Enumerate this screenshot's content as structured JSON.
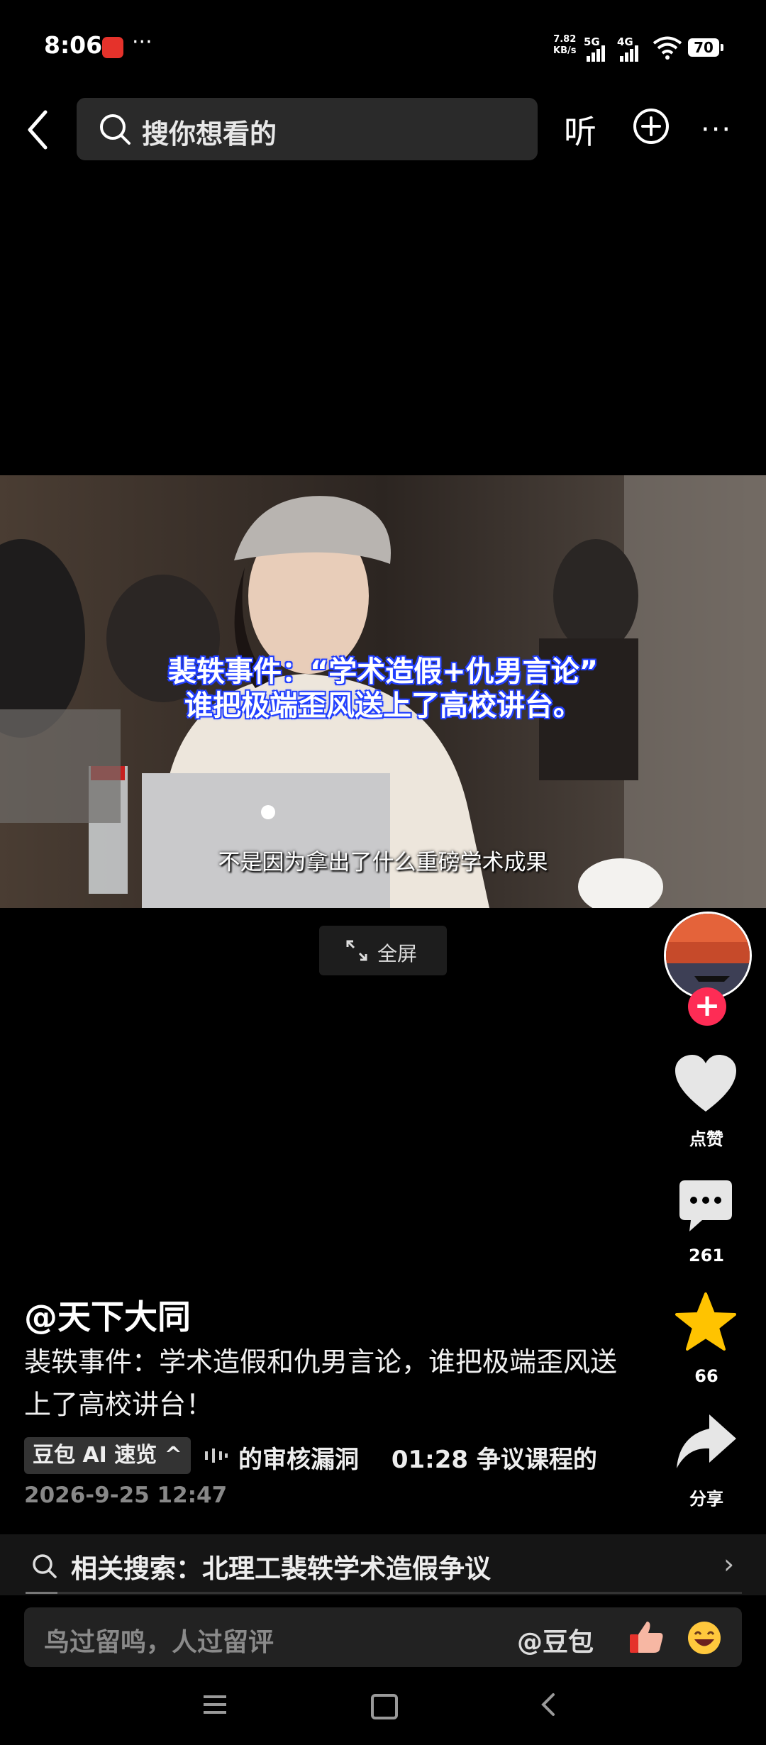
{
  "status_bar": {
    "time": "8:06",
    "more": "···",
    "net_speed_value": "7.82",
    "net_speed_unit": "KB/s",
    "sig1_label": "5G",
    "sig2_label": "4G",
    "battery": "70"
  },
  "top_nav": {
    "search_placeholder": "搜你想看的",
    "listen_label": "听",
    "more_label": "···"
  },
  "video": {
    "title_line1": "裴轶事件：“学术造假+仇男言论”",
    "title_line2": "谁把极端歪风送上了高校讲台。",
    "caption": "不是因为拿出了什么重磅学术成果",
    "fullscreen_label": "全屏"
  },
  "rail": {
    "follow": "+",
    "like_label": "点赞",
    "comment_count": "261",
    "favorite_count": "66",
    "share_label": "分享"
  },
  "post": {
    "author": "@天下大同",
    "description": "裴轶事件：学术造假和仇男言论，谁把极端歪风送上了高校讲台！",
    "ai_badge": "豆包 AI 速览 ^",
    "ai_summary": "的审核漏洞　 01:28 争议课程的",
    "date": "2026-9-25 12:47"
  },
  "related_search": {
    "label": "相关搜索：北理工裴轶学术造假争议",
    "arrow": "›"
  },
  "comment_bar": {
    "placeholder": "鸟过留鸣，人过留评",
    "mention": "@豆包"
  },
  "colors": {
    "accent_red": "#fe2c55",
    "star_yellow": "#ffc300",
    "subtitle_outline": "#2340ff"
  }
}
